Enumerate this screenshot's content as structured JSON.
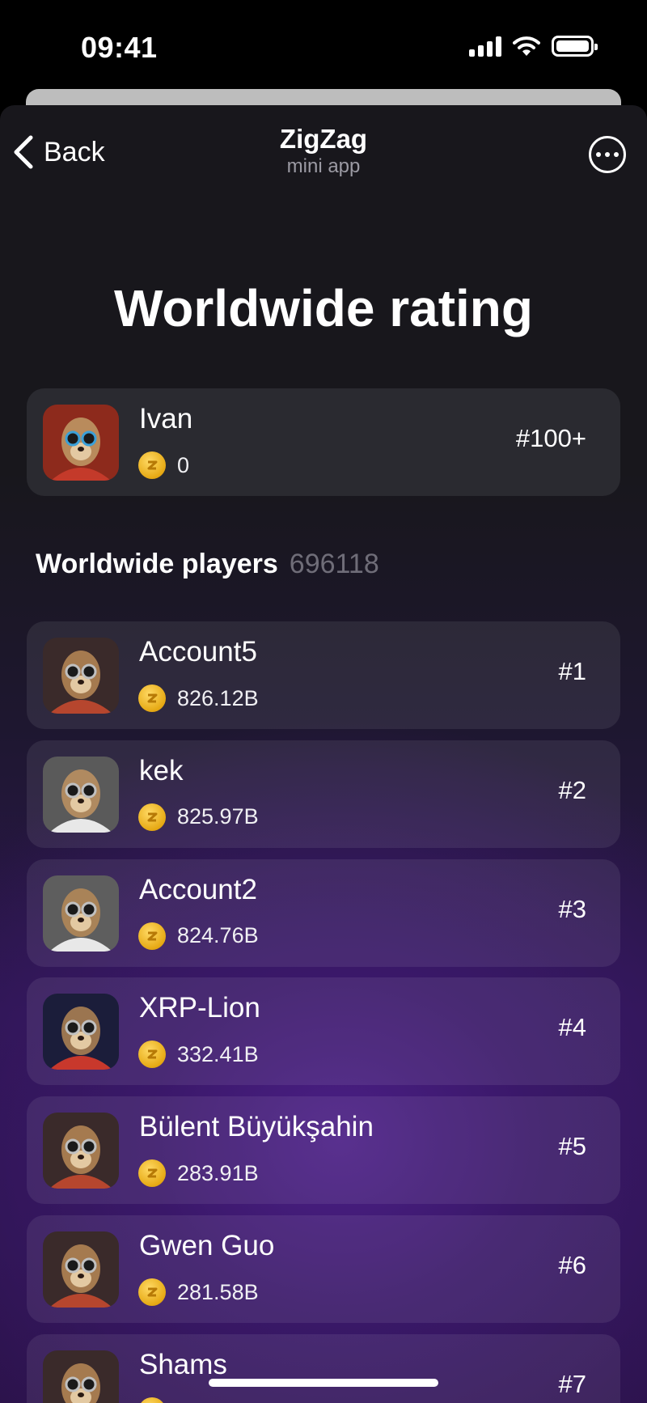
{
  "status": {
    "time": "09:41"
  },
  "nav": {
    "back_label": "Back",
    "title": "ZigZag",
    "subtitle": "mini app"
  },
  "page_title": "Worldwide rating",
  "me": {
    "name": "Ivan",
    "score": "0",
    "rank": "#100+"
  },
  "section": {
    "title": "Worldwide players",
    "count": "696118"
  },
  "players": [
    {
      "name": "Account5",
      "score": "826.12B",
      "rank": "#1"
    },
    {
      "name": "kek",
      "score": "825.97B",
      "rank": "#2"
    },
    {
      "name": "Account2",
      "score": "824.76B",
      "rank": "#3"
    },
    {
      "name": "XRP-Lion",
      "score": "332.41B",
      "rank": "#4"
    },
    {
      "name": "Bülent Büyükşahin",
      "score": "283.91B",
      "rank": "#5"
    },
    {
      "name": "Gwen Guo",
      "score": "281.58B",
      "rank": "#6"
    },
    {
      "name": "Shams",
      "score": "",
      "rank": "#7"
    }
  ],
  "colors": {
    "accent": "#4b1f86",
    "coin": "#f2bd2e",
    "card": "#2a2a30"
  },
  "icons": [
    "signal-icon",
    "wifi-icon",
    "battery-icon",
    "back-chevron-icon",
    "more-icon",
    "coin-icon",
    "avatar-meerkat-icon"
  ]
}
